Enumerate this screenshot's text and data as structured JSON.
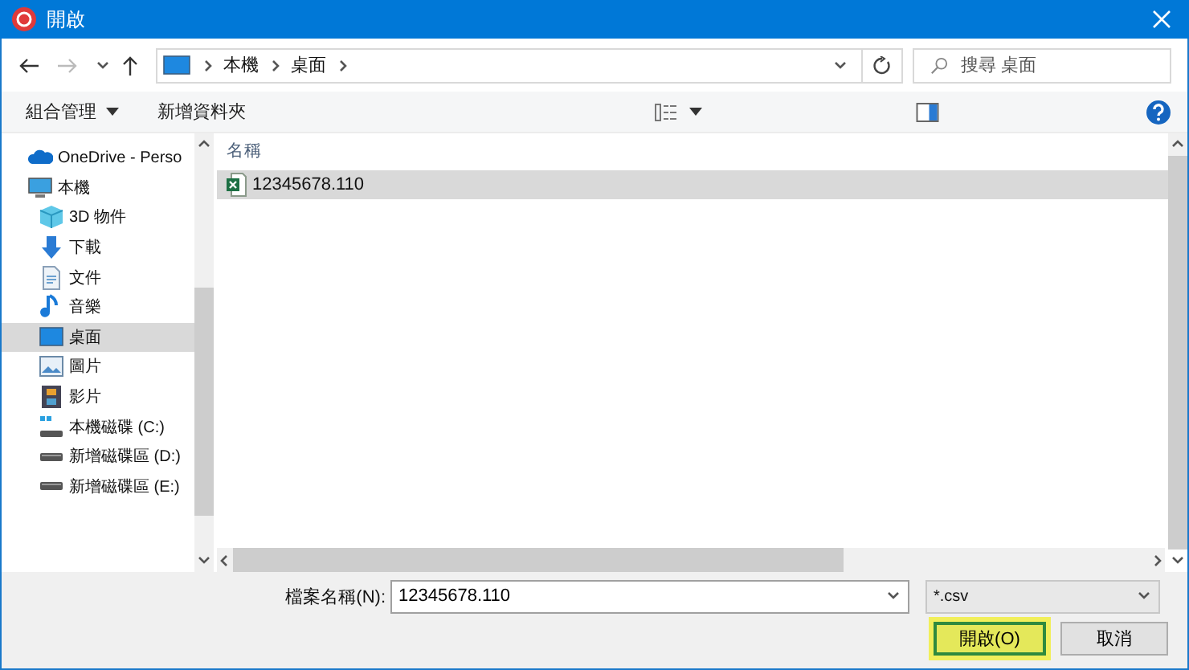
{
  "window": {
    "title": "開啟"
  },
  "navigation": {
    "breadcrumb": [
      {
        "label": "本機"
      },
      {
        "label": "桌面"
      }
    ],
    "search": {
      "placeholder": "搜尋 桌面"
    }
  },
  "toolbar": {
    "organize": "組合管理",
    "new_folder": "新增資料夾"
  },
  "sidebar": {
    "items": [
      {
        "label": "OneDrive - Perso",
        "kind": "cloud",
        "selected": false
      },
      {
        "label": "本機",
        "kind": "computer",
        "selected": false,
        "children": [
          {
            "label": "3D 物件",
            "kind": "cube",
            "selected": false
          },
          {
            "label": "下載",
            "kind": "download",
            "selected": false
          },
          {
            "label": "文件",
            "kind": "document",
            "selected": false
          },
          {
            "label": "音樂",
            "kind": "music",
            "selected": false
          },
          {
            "label": "桌面",
            "kind": "desktop",
            "selected": true
          },
          {
            "label": "圖片",
            "kind": "pictures",
            "selected": false
          },
          {
            "label": "影片",
            "kind": "videos",
            "selected": false
          },
          {
            "label": "本機磁碟 (C:)",
            "kind": "system-drive",
            "selected": false
          },
          {
            "label": "新增磁碟區 (D:)",
            "kind": "drive",
            "selected": false
          },
          {
            "label": "新增磁碟區 (E:)",
            "kind": "drive",
            "selected": false
          }
        ]
      }
    ]
  },
  "file_list": {
    "columns": [
      "名稱"
    ],
    "rows": [
      {
        "name": "12345678.110",
        "kind": "spreadsheet",
        "selected": true
      }
    ]
  },
  "footer": {
    "filename_label": "檔案名稱(N):",
    "filename": "12345678.110",
    "file_type": "*.csv",
    "buttons": [
      {
        "label": "開啟(O)",
        "highlighted": true
      },
      {
        "label": "取消",
        "highlighted": false
      }
    ]
  }
}
